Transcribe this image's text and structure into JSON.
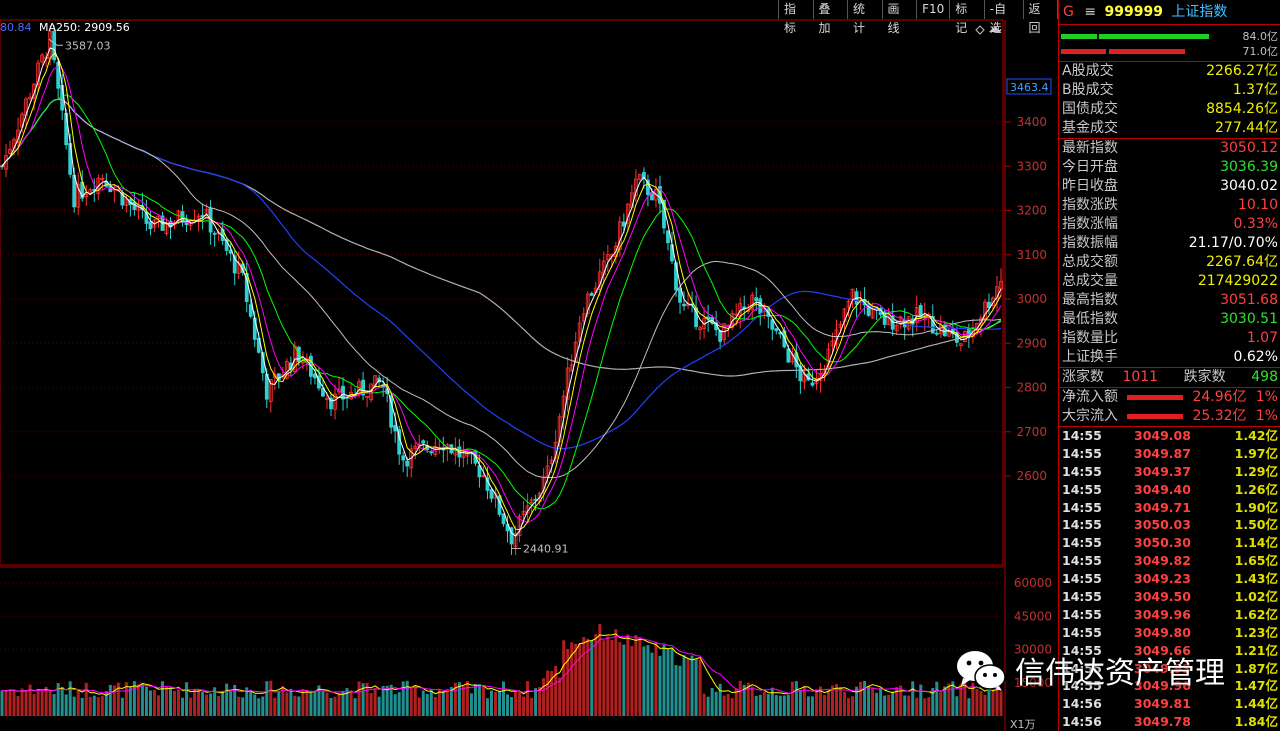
{
  "toolbar": [
    "指标",
    "叠加",
    "统计",
    "画线",
    "F10",
    "标记",
    "-自选",
    "返回"
  ],
  "ma_legend": {
    "prefix": "80.84",
    "ma250": "MA250: 2909.56"
  },
  "price_axis": {
    "ticks": [
      "3400",
      "3300",
      "3200",
      "3100",
      "3000",
      "2900",
      "2800",
      "2700",
      "2600"
    ],
    "current": "3463.4"
  },
  "volume_axis": {
    "ticks": [
      "60000",
      "45000",
      "30000",
      "15000"
    ],
    "unit": "X1万"
  },
  "annotations": {
    "high": "3587.03",
    "low": "2440.91"
  },
  "colors": {
    "up": "#ff3030",
    "down": "#30d0d0",
    "ma5": "#ffffff",
    "ma10": "#ffff00",
    "ma20": "#ff00ff",
    "ma30": "#00ff00",
    "ma60": "#c0c0c0",
    "ma120": "#2040ff",
    "ma250": "#b0b0b0",
    "panel_border": "#b00000"
  },
  "header": {
    "g": "G",
    "eq": "≡",
    "code": "999999",
    "name": "上证指数"
  },
  "bars": {
    "v1": "84.0亿",
    "v2": "71.0亿"
  },
  "stats_a": [
    {
      "label": "A股成交",
      "value": "2266.27亿",
      "color": "yellow"
    },
    {
      "label": "B股成交",
      "value": "1.37亿",
      "color": "yellow"
    },
    {
      "label": "国债成交",
      "value": "8854.26亿",
      "color": "yellow"
    },
    {
      "label": "基金成交",
      "value": "277.44亿",
      "color": "yellow"
    }
  ],
  "stats_b": [
    {
      "label": "最新指数",
      "value": "3050.12",
      "color": "red"
    },
    {
      "label": "今日开盘",
      "value": "3036.39",
      "color": "green"
    },
    {
      "label": "昨日收盘",
      "value": "3040.02",
      "color": "white"
    },
    {
      "label": "指数涨跌",
      "value": "10.10",
      "color": "red"
    },
    {
      "label": "指数涨幅",
      "value": "0.33%",
      "color": "red"
    },
    {
      "label": "指数振幅",
      "value": "21.17/0.70%",
      "color": "white"
    },
    {
      "label": "总成交额",
      "value": "2267.64亿",
      "color": "yellow"
    },
    {
      "label": "总成交量",
      "value": "217429022",
      "color": "yellow"
    },
    {
      "label": "最高指数",
      "value": "3051.68",
      "color": "red"
    },
    {
      "label": "最低指数",
      "value": "3030.51",
      "color": "green"
    },
    {
      "label": "指数量比",
      "value": "1.07",
      "color": "red"
    },
    {
      "label": "上证换手",
      "value": "0.62%",
      "color": "white"
    }
  ],
  "advdec": {
    "up_label": "涨家数",
    "up": "1011",
    "down_label": "跌家数",
    "down": "498"
  },
  "flows": [
    {
      "label": "净流入额",
      "value": "24.96亿",
      "pct": "1%"
    },
    {
      "label": "大宗流入",
      "value": "25.32亿",
      "pct": "1%"
    }
  ],
  "ticks": [
    {
      "t": "14:55",
      "p": "3049.08",
      "v": "1.42亿"
    },
    {
      "t": "14:55",
      "p": "3049.87",
      "v": "1.97亿"
    },
    {
      "t": "14:55",
      "p": "3049.37",
      "v": "1.29亿"
    },
    {
      "t": "14:55",
      "p": "3049.40",
      "v": "1.26亿"
    },
    {
      "t": "14:55",
      "p": "3049.71",
      "v": "1.90亿"
    },
    {
      "t": "14:55",
      "p": "3050.03",
      "v": "1.50亿"
    },
    {
      "t": "14:55",
      "p": "3050.30",
      "v": "1.14亿"
    },
    {
      "t": "14:55",
      "p": "3049.82",
      "v": "1.65亿"
    },
    {
      "t": "14:55",
      "p": "3049.23",
      "v": "1.43亿"
    },
    {
      "t": "14:55",
      "p": "3049.50",
      "v": "1.02亿"
    },
    {
      "t": "14:55",
      "p": "3049.96",
      "v": "1.62亿"
    },
    {
      "t": "14:55",
      "p": "3049.80",
      "v": "1.23亿"
    },
    {
      "t": "14:55",
      "p": "3049.66",
      "v": "1.21亿"
    },
    {
      "t": "14:55",
      "p": "3049.93",
      "v": "1.87亿"
    },
    {
      "t": "14:55",
      "p": "3049.96",
      "v": "1.47亿"
    },
    {
      "t": "14:56",
      "p": "3049.81",
      "v": "1.44亿"
    },
    {
      "t": "14:56",
      "p": "3049.78",
      "v": "1.84亿"
    }
  ],
  "watermark": "信伟达资产管理"
}
